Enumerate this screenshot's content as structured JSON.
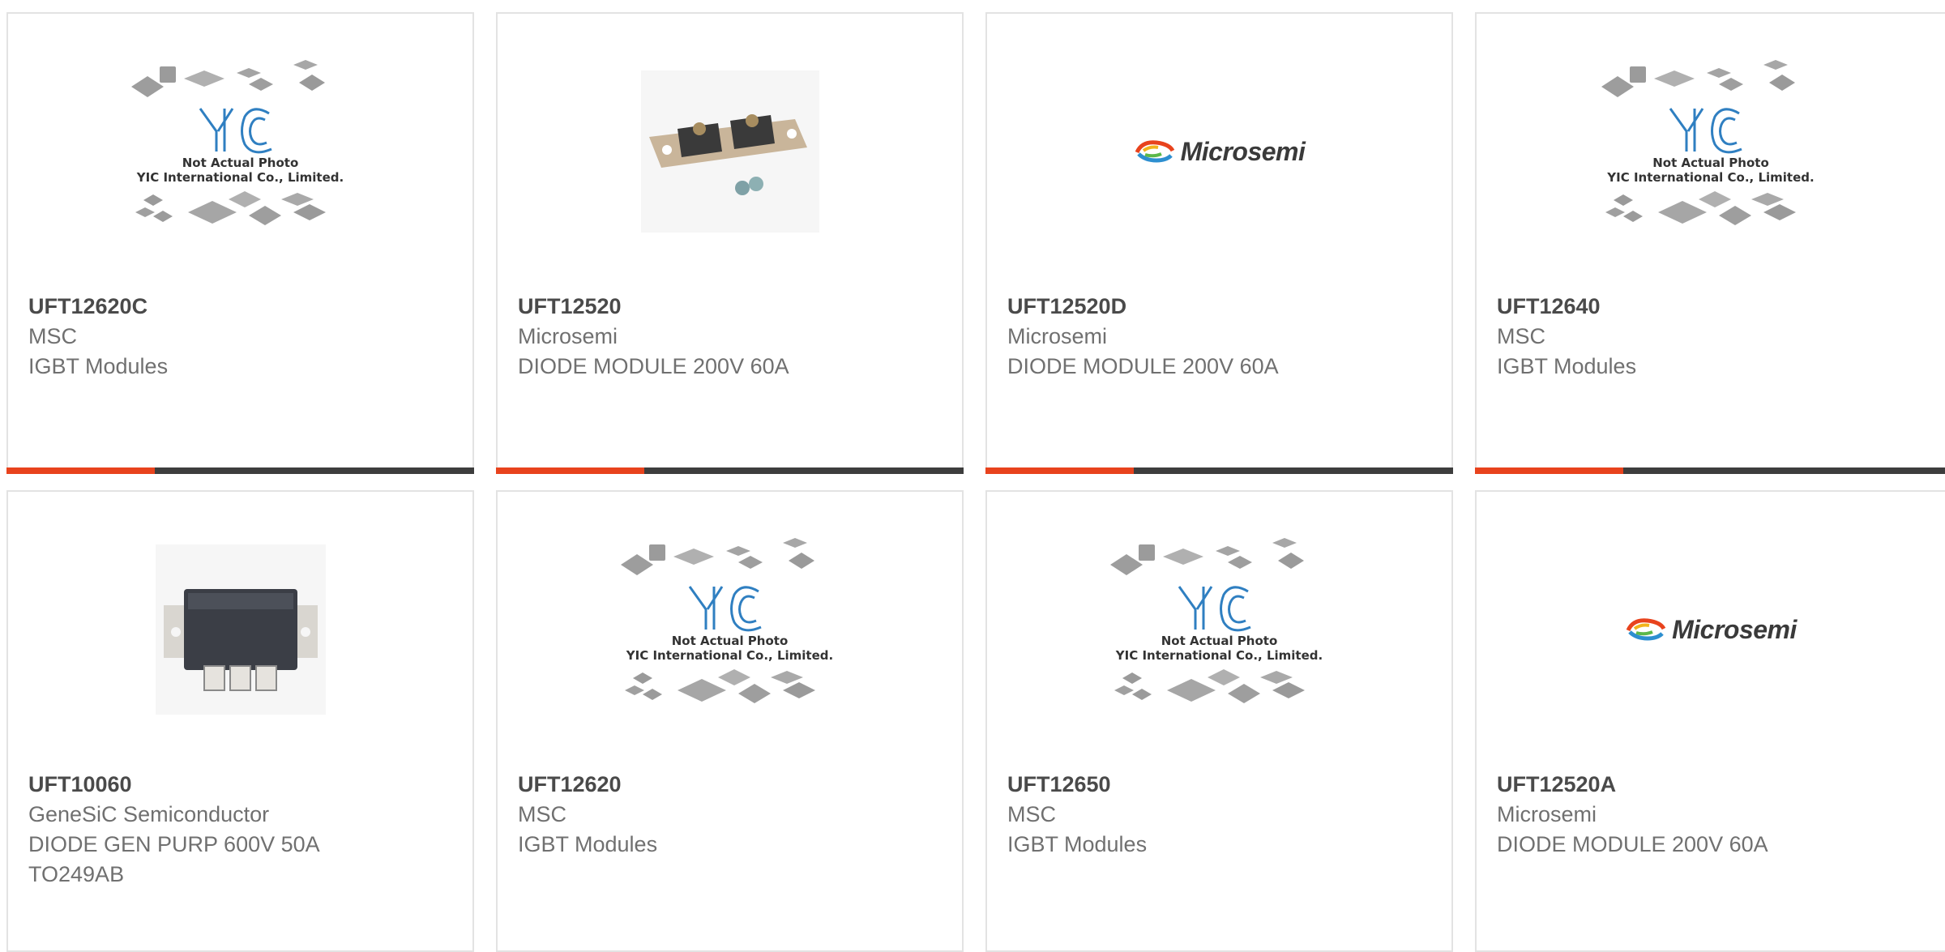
{
  "products": [
    {
      "part": "UFT12620C",
      "manufacturer": "MSC",
      "description": "IGBT Modules",
      "image": "placeholder",
      "highlight": true,
      "placeholder_text": [
        "Not Actual Photo",
        "YIC International Co., Limited."
      ]
    },
    {
      "part": "UFT12520",
      "manufacturer": "Microsemi",
      "description": "DIODE MODULE 200V 60A",
      "image": "diode-module-photo",
      "highlight": true
    },
    {
      "part": "UFT12520D",
      "manufacturer": "Microsemi",
      "description": "DIODE MODULE 200V 60A",
      "image": "microsemi-logo",
      "highlight": true,
      "logo_text": "Microsemi"
    },
    {
      "part": "UFT12640",
      "manufacturer": "MSC",
      "description": "IGBT Modules",
      "image": "placeholder",
      "highlight": true,
      "placeholder_text": [
        "Not Actual Photo",
        "YIC International Co., Limited."
      ]
    },
    {
      "part": "UFT10060",
      "manufacturer": "GeneSiC Semiconductor",
      "description": "DIODE GEN PURP 600V 50A TO249AB",
      "image": "to249ab-photo",
      "highlight": false
    },
    {
      "part": "UFT12620",
      "manufacturer": "MSC",
      "description": "IGBT Modules",
      "image": "placeholder",
      "highlight": false,
      "placeholder_text": [
        "Not Actual Photo",
        "YIC International Co., Limited."
      ]
    },
    {
      "part": "UFT12650",
      "manufacturer": "MSC",
      "description": "IGBT Modules",
      "image": "placeholder",
      "highlight": false,
      "placeholder_text": [
        "Not Actual Photo",
        "YIC International Co., Limited."
      ]
    },
    {
      "part": "UFT12520A",
      "manufacturer": "Microsemi",
      "description": "DIODE MODULE 200V 60A",
      "image": "microsemi-logo",
      "highlight": false,
      "logo_text": "Microsemi"
    }
  ],
  "colors": {
    "accent": "#e8431d",
    "bar": "#3d3d3d",
    "border": "#e3e3e3",
    "yic_blue": "#2f7fc1"
  }
}
